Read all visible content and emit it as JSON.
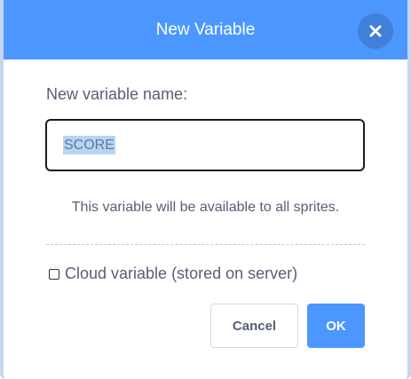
{
  "dialog": {
    "title": "New Variable",
    "close_icon": "close-icon",
    "prompt_label": "New variable name:",
    "name_input": {
      "value": "SCORE",
      "selected": true
    },
    "info_text": "This variable will be available to all sprites.",
    "cloud_checkbox": {
      "label": "Cloud variable (stored on server)",
      "checked": false
    },
    "buttons": {
      "cancel_label": "Cancel",
      "ok_label": "OK"
    }
  },
  "colors": {
    "header": "#4c97ff",
    "ok_button": "#4c97ff",
    "text": "#575e75",
    "selection": "#b6d4f3"
  }
}
